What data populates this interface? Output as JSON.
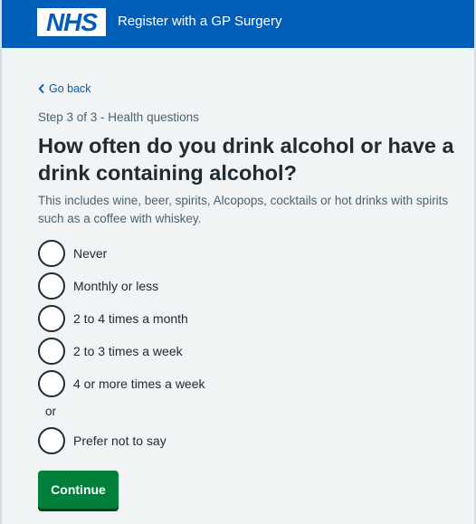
{
  "header": {
    "logo_text": "NHS",
    "service_name": "Register with a GP Surgery",
    "brand_color": "#005eb8"
  },
  "back_link": {
    "label": "Go back",
    "icon": "chevron-left-icon"
  },
  "step": "Step 3 of 3 - Health questions",
  "question": "How often do you drink alcohol or have a drink containing alcohol?",
  "hint": "This includes wine, beer, spirits, Alcopops, cocktails or hot drinks with spirits such as a coffee with whiskey.",
  "options": [
    {
      "label": "Never",
      "selected": false
    },
    {
      "label": "Monthly or less",
      "selected": false
    },
    {
      "label": "2 to 4 times a month",
      "selected": false
    },
    {
      "label": "2 to 3 times a week",
      "selected": false
    },
    {
      "label": "4 or more times a week",
      "selected": false
    }
  ],
  "or_divider": "or",
  "prefer_option": {
    "label": "Prefer not to say",
    "selected": false
  },
  "continue_button": {
    "label": "Continue",
    "color": "#007f3b"
  }
}
